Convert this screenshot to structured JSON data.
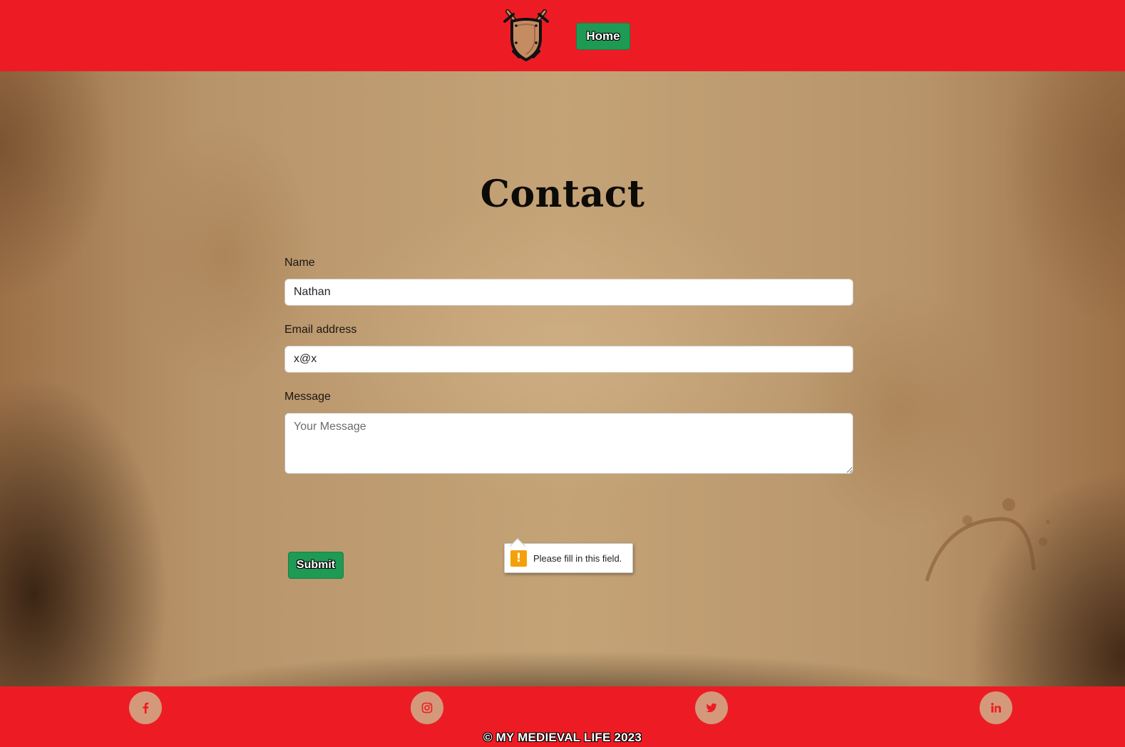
{
  "header": {
    "logo_icon": "shield-with-swords-icon",
    "nav": [
      {
        "label": "Home"
      }
    ]
  },
  "main": {
    "title": "Contact"
  },
  "form": {
    "name": {
      "label": "Name",
      "value": "Nathan"
    },
    "email": {
      "label": "Email address",
      "value": "x@x"
    },
    "message": {
      "label": "Message",
      "value": "",
      "placeholder": "Your Message"
    },
    "submit_label": "Submit"
  },
  "validation": {
    "icon": "warning-icon",
    "icon_glyph": "!",
    "message": "Please fill in this field."
  },
  "footer": {
    "social": [
      {
        "name": "facebook",
        "icon": "facebook-icon"
      },
      {
        "name": "instagram",
        "icon": "instagram-icon"
      },
      {
        "name": "twitter",
        "icon": "twitter-icon"
      },
      {
        "name": "linkedin",
        "icon": "linkedin-icon"
      }
    ],
    "copyright": "© MY MEDIEVAL LIFE 2023"
  },
  "colors": {
    "header_bg": "#ed1c24",
    "button_green": "#1e9a55",
    "social_circle": "#d4997a",
    "warning": "#f5a00a"
  }
}
